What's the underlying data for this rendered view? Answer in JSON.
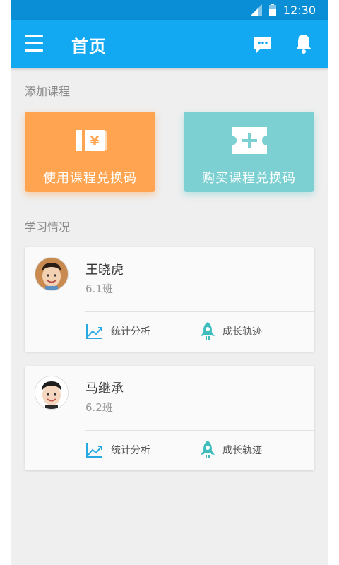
{
  "status": {
    "time": "12:30"
  },
  "header": {
    "title": "首页"
  },
  "add_course": {
    "section_label": "添加课程",
    "use_code_label": "使用课程兑换码",
    "buy_code_label": "购买课程兑换码"
  },
  "study": {
    "section_label": "学习情况",
    "students": [
      {
        "name": "王晓虎",
        "class": "6.1班",
        "stats_label": "统计分析",
        "growth_label": "成长轨迹"
      },
      {
        "name": "马继承",
        "class": "6.2班",
        "stats_label": "统计分析",
        "growth_label": "成长轨迹"
      }
    ]
  },
  "colors": {
    "status_bar": "#0a8fd6",
    "app_bar": "#12a8f2",
    "orange_card": "#ffa552",
    "teal_card": "#7cd0d2",
    "accent_icon": "#29a9e1"
  },
  "icons": [
    "menu-icon",
    "message-icon",
    "bell-icon",
    "ticket-yen-icon",
    "ticket-plus-icon",
    "chart-trend-icon",
    "rocket-icon",
    "signal-icon",
    "battery-icon"
  ]
}
